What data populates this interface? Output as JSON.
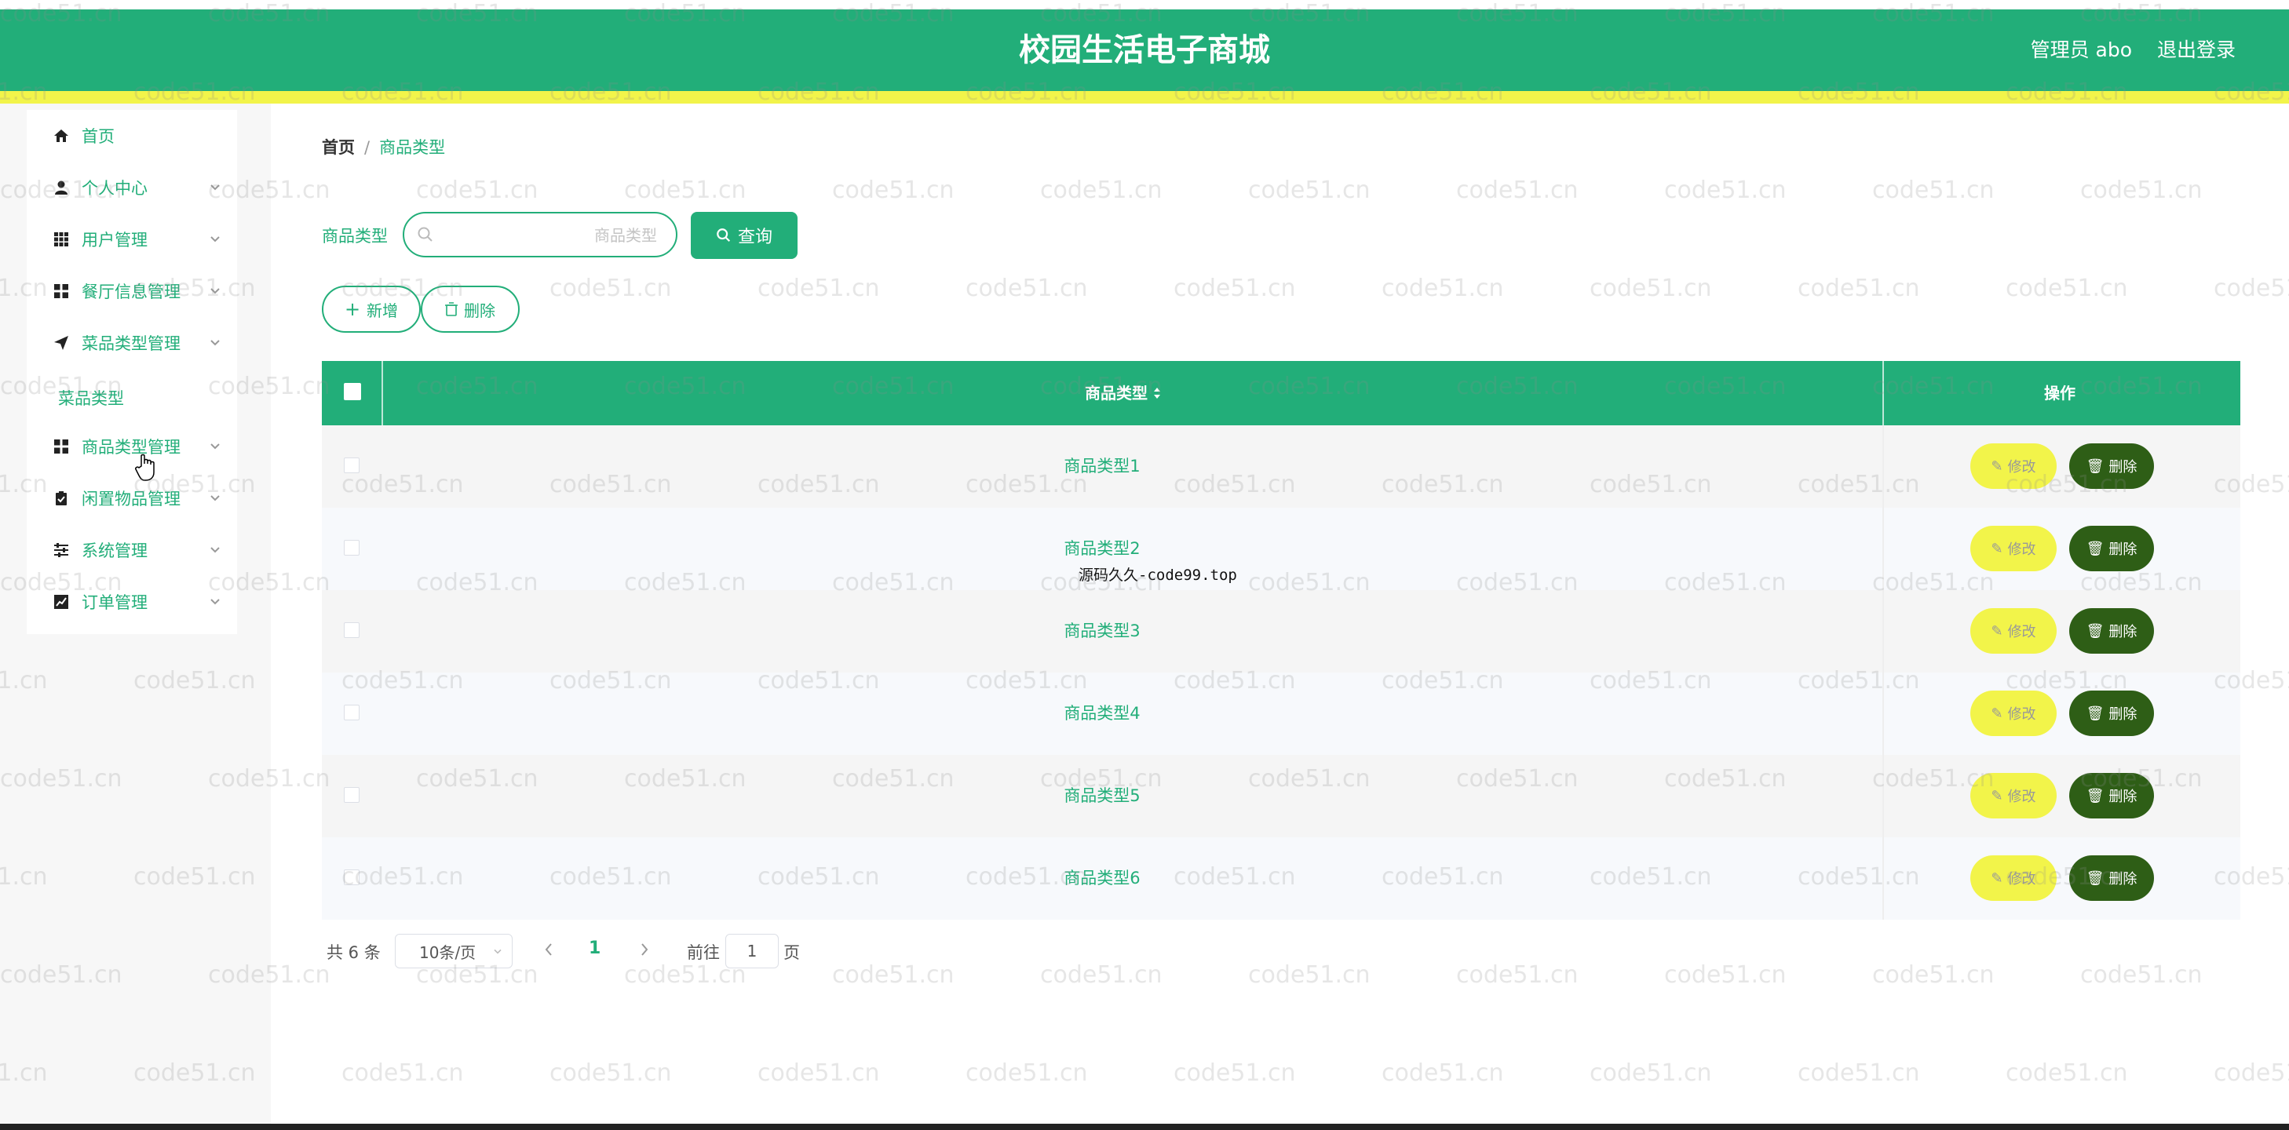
{
  "header": {
    "title": "校园生活电子商城",
    "admin": "管理员 abo",
    "logout": "退出登录"
  },
  "sidebar": {
    "items": [
      {
        "label": "首页",
        "icon": "home-icon"
      },
      {
        "label": "个人中心",
        "icon": "user-icon"
      },
      {
        "label": "用户管理",
        "icon": "grid-icon"
      },
      {
        "label": "餐厅信息管理",
        "icon": "apps-icon"
      },
      {
        "label": "菜品类型管理",
        "icon": "send-icon"
      },
      {
        "label": "商品类型管理",
        "icon": "apps-icon"
      },
      {
        "label": "闲置物品管理",
        "icon": "clipboard-icon"
      },
      {
        "label": "系统管理",
        "icon": "sliders-icon"
      },
      {
        "label": "订单管理",
        "icon": "chart-icon"
      }
    ],
    "submenu_label": "菜品类型"
  },
  "breadcrumb": {
    "home": "首页",
    "separator": "/",
    "current": "商品类型"
  },
  "search": {
    "label": "商品类型",
    "placeholder": "商品类型",
    "query_button": "查询"
  },
  "actions": {
    "add": "新增",
    "delete": "删除"
  },
  "table": {
    "columns": [
      "商品类型",
      "操作"
    ],
    "rows": [
      {
        "type": "商品类型1"
      },
      {
        "type": "商品类型2"
      },
      {
        "type": "商品类型3"
      },
      {
        "type": "商品类型4"
      },
      {
        "type": "商品类型5"
      },
      {
        "type": "商品类型6"
      }
    ],
    "edit_label": "修改",
    "delete_label": "删除"
  },
  "pagination": {
    "total": "共 6 条",
    "page_size": "10条/页",
    "current_page": "1",
    "goto_label": "前往",
    "goto_value": "1",
    "page_suffix": "页"
  },
  "overlay_text": "源码久久-code99.top",
  "watermark": "code51.cn",
  "colors": {
    "primary": "#22ae79",
    "accent_yellow": "#f2f44a",
    "delete_dark": "#2e5e16"
  }
}
